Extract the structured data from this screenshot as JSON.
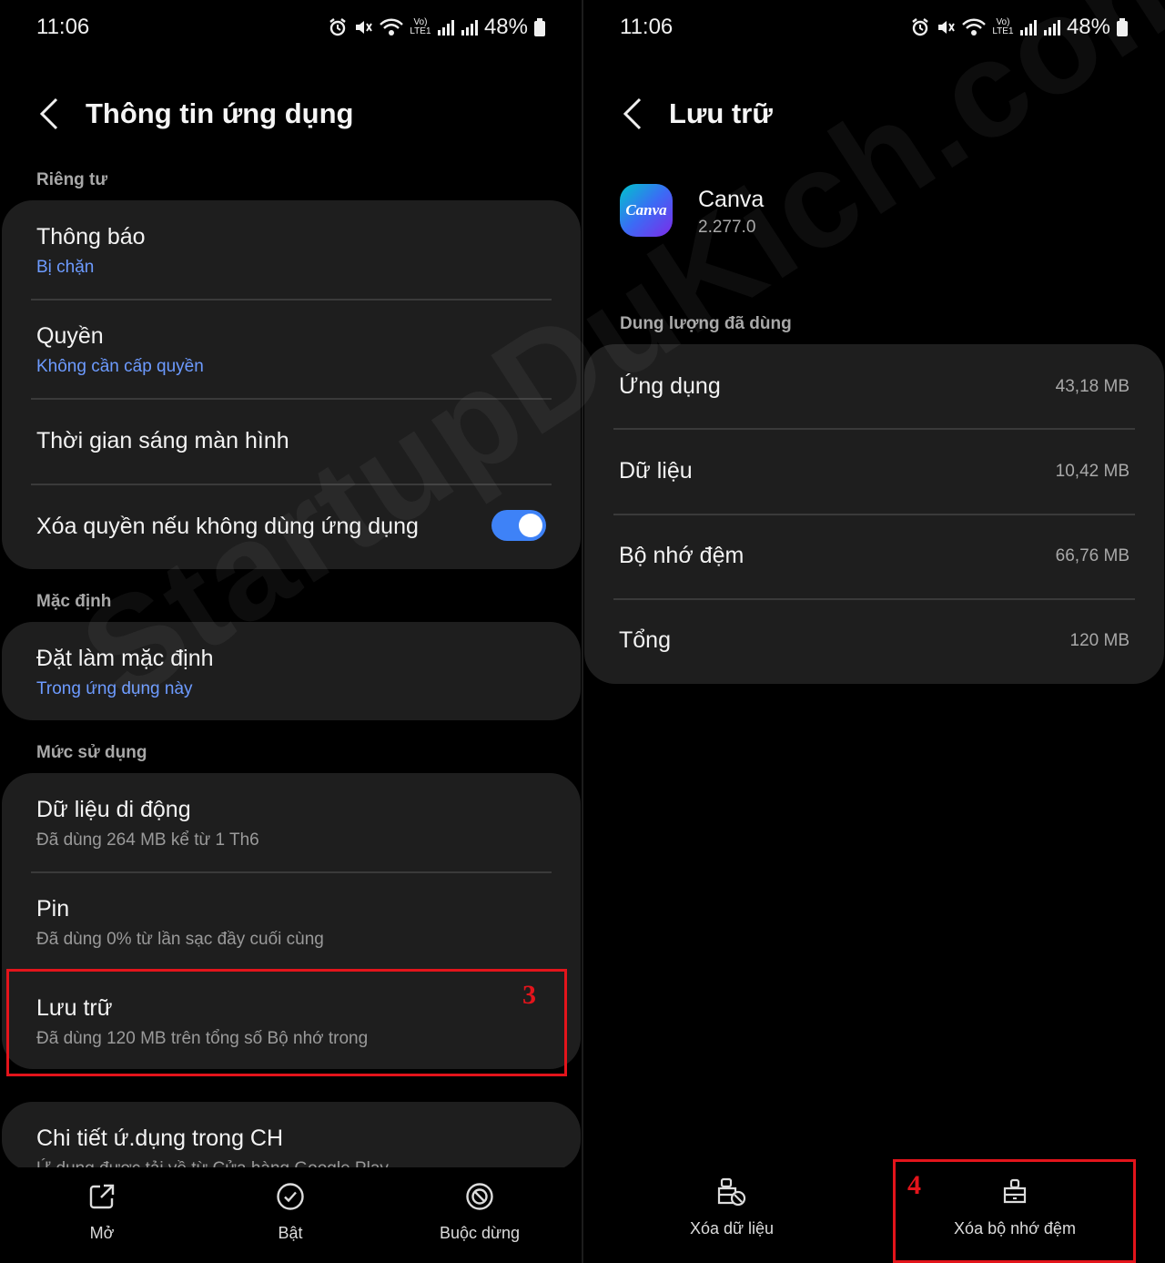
{
  "status": {
    "time": "11:06",
    "battery": "48%",
    "lte_label": "Vo) LTE1"
  },
  "left": {
    "title": "Thông tin ứng dụng",
    "sections": {
      "privacy": "Riêng tư",
      "default": "Mặc định",
      "usage": "Mức sử dụng"
    },
    "rows": {
      "notifications": {
        "title": "Thông báo",
        "sub": "Bị chặn"
      },
      "permissions": {
        "title": "Quyền",
        "sub": "Không cần cấp quyền"
      },
      "screen_time": {
        "title": "Thời gian sáng màn hình"
      },
      "remove_permissions": {
        "title": "Xóa quyền nếu không dùng ứng dụng",
        "toggle_on": true
      },
      "set_default": {
        "title": "Đặt làm mặc định",
        "sub": "Trong ứng dụng này"
      },
      "mobile_data": {
        "title": "Dữ liệu di động",
        "sub": "Đã dùng 264 MB kể từ 1 Th6"
      },
      "battery": {
        "title": "Pin",
        "sub": "Đã dùng 0% từ lần sạc đầy cuối cùng"
      },
      "storage": {
        "title": "Lưu trữ",
        "sub": "Đã dùng 120 MB trên tổng số Bộ nhớ trong"
      },
      "store_details": {
        "title": "Chi tiết ứ.dụng trong CH",
        "sub": "Ứ.dụng được tải về từ Cửa hàng Google Play"
      }
    },
    "marker": "3",
    "bottom": {
      "open": "Mở",
      "enable": "Bật",
      "force_stop": "Buộc dừng"
    }
  },
  "right": {
    "title": "Lưu trữ",
    "app": {
      "name": "Canva",
      "version": "2.277.0",
      "icon_text": "Canva"
    },
    "section": "Dung lượng đã dùng",
    "rows": [
      {
        "label": "Ứng dụng",
        "value": "43,18 MB"
      },
      {
        "label": "Dữ liệu",
        "value": "10,42 MB"
      },
      {
        "label": "Bộ nhớ đệm",
        "value": "66,76 MB"
      },
      {
        "label": "Tổng",
        "value": "120 MB"
      }
    ],
    "marker": "4",
    "bottom": {
      "clear_data": "Xóa dữ liệu",
      "clear_cache": "Xóa bộ nhớ đệm"
    }
  },
  "watermark": "StartupDuKich.com",
  "colors": {
    "accent": "#3e82f7",
    "link": "#6d9bff",
    "highlight": "#e3141b",
    "card": "#1e1e1e"
  }
}
